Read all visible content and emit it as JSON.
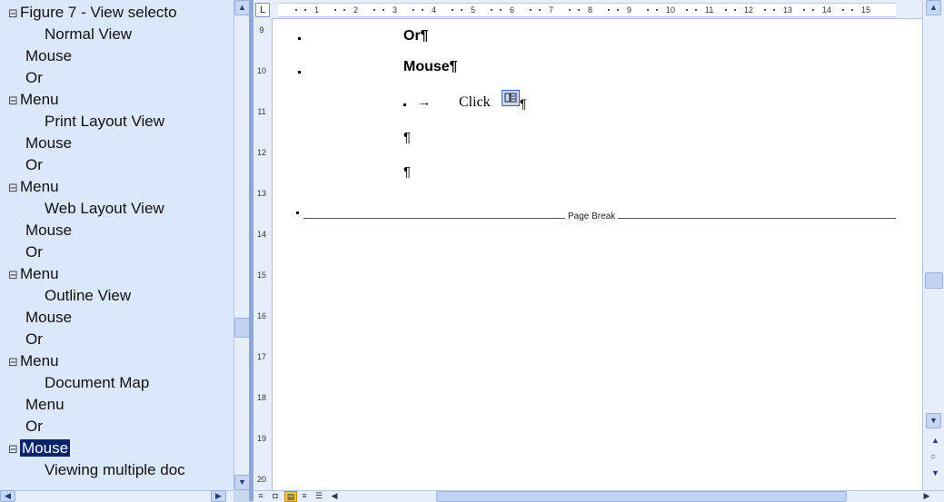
{
  "document_map": {
    "items": [
      {
        "text": "Figure 7 - View selecto",
        "indent": 0,
        "expander": "⊟",
        "selected": false
      },
      {
        "text": "Normal View",
        "indent": 2,
        "expander": "",
        "selected": false
      },
      {
        "text": "Mouse",
        "indent": 1,
        "expander": "",
        "selected": false
      },
      {
        "text": "Or",
        "indent": 1,
        "expander": "",
        "selected": false
      },
      {
        "text": "Menu",
        "indent": 0,
        "expander": "⊟",
        "selected": false
      },
      {
        "text": "Print Layout View",
        "indent": 2,
        "expander": "",
        "selected": false
      },
      {
        "text": "Mouse",
        "indent": 1,
        "expander": "",
        "selected": false
      },
      {
        "text": "Or",
        "indent": 1,
        "expander": "",
        "selected": false
      },
      {
        "text": "Menu",
        "indent": 0,
        "expander": "⊟",
        "selected": false
      },
      {
        "text": "Web Layout View",
        "indent": 2,
        "expander": "",
        "selected": false
      },
      {
        "text": "Mouse",
        "indent": 1,
        "expander": "",
        "selected": false
      },
      {
        "text": "Or",
        "indent": 1,
        "expander": "",
        "selected": false
      },
      {
        "text": "Menu",
        "indent": 0,
        "expander": "⊟",
        "selected": false
      },
      {
        "text": "Outline View",
        "indent": 2,
        "expander": "",
        "selected": false
      },
      {
        "text": "Mouse",
        "indent": 1,
        "expander": "",
        "selected": false
      },
      {
        "text": "Or",
        "indent": 1,
        "expander": "",
        "selected": false
      },
      {
        "text": "Menu",
        "indent": 0,
        "expander": "⊟",
        "selected": false
      },
      {
        "text": "Document Map",
        "indent": 2,
        "expander": "",
        "selected": false
      },
      {
        "text": "Menu",
        "indent": 1,
        "expander": "",
        "selected": false
      },
      {
        "text": "Or",
        "indent": 1,
        "expander": "",
        "selected": false
      },
      {
        "text": "Mouse",
        "indent": 0,
        "expander": "⊟",
        "selected": true
      },
      {
        "text": "Viewing multiple doc",
        "indent": 2,
        "expander": "",
        "selected": false
      }
    ]
  },
  "ruler": {
    "h_numbers": [
      "1",
      "2",
      "3",
      "4",
      "5",
      "6",
      "7",
      "8",
      "9",
      "10",
      "11",
      "12",
      "13",
      "14",
      "15"
    ],
    "v_numbers": [
      "9",
      "10",
      "11",
      "12",
      "13",
      "14",
      "15",
      "16",
      "17",
      "18",
      "19",
      "20"
    ]
  },
  "document": {
    "or_text": "Or¶",
    "mouse_text": "Mouse¶",
    "click_text": "Click",
    "tab_arrow": "→",
    "pilcrow": "¶",
    "page_break": "Page Break"
  },
  "colors": {
    "selection": "#0a246a",
    "panel_bg": "#dbe7fb",
    "chrome": "#e6eefc"
  }
}
